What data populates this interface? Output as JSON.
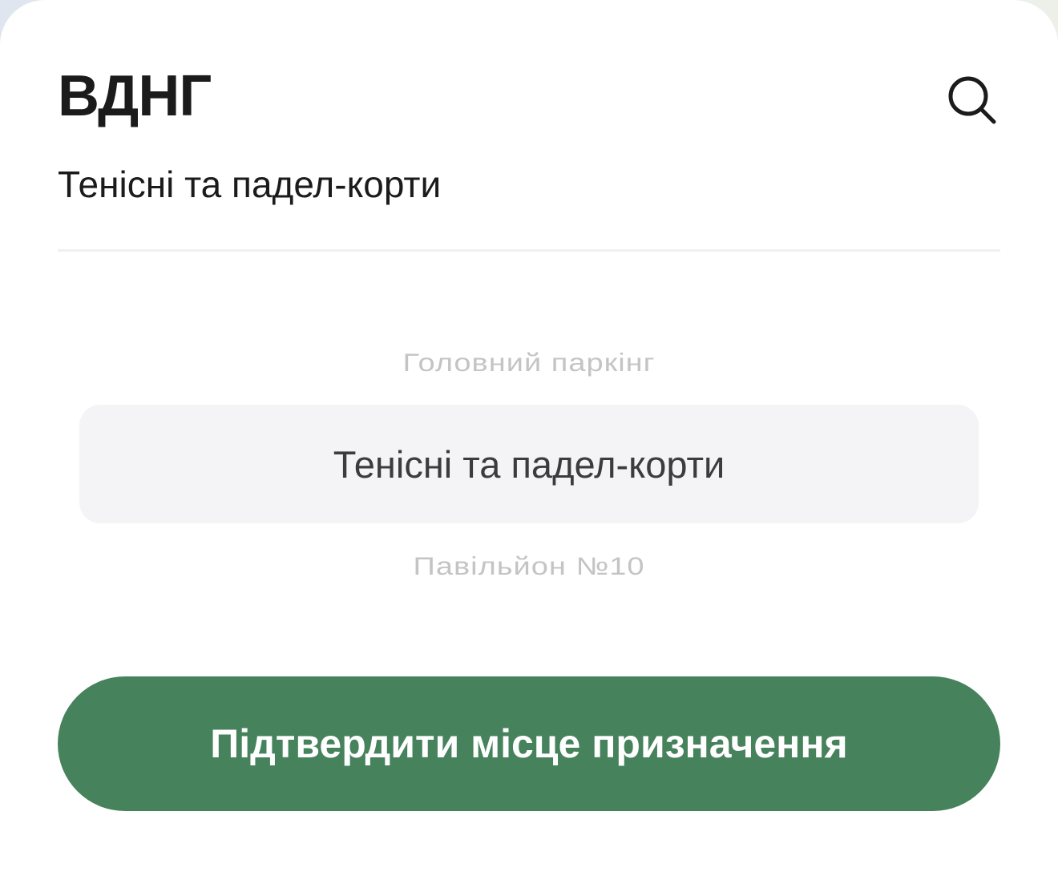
{
  "sheet": {
    "title": "ВДНГ",
    "subtitle": "Тенісні та падел-корти",
    "search_icon": "search-icon"
  },
  "picker": {
    "previous_option": "Головний паркінг",
    "selected_option": "Тенісні та падел-корти",
    "next_option": "Павільйон №10"
  },
  "confirm_button": {
    "label": "Підтвердити місце призначення"
  },
  "colors": {
    "accent": "#46825c",
    "text_primary": "#1b1b1b",
    "text_muted": "#c4c4c6",
    "selection_bg": "#f4f4f6"
  }
}
